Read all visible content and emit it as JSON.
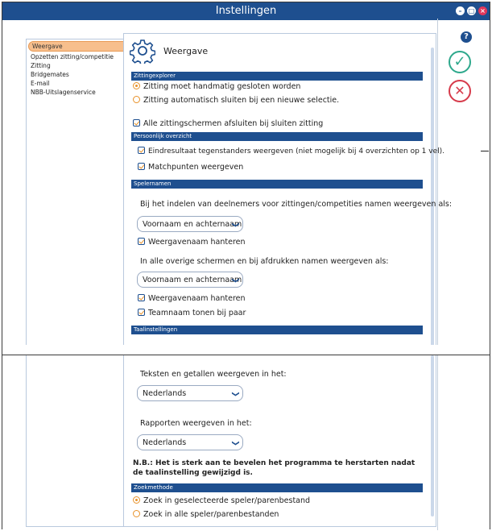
{
  "window": {
    "title": "Instellingen",
    "help_label": "?",
    "ok_label": "✓",
    "cancel_label": "✕"
  },
  "sidebar": {
    "items": [
      {
        "label": "Weergave",
        "active": true
      },
      {
        "label": "Opzetten zitting/competitie"
      },
      {
        "label": "Zitting"
      },
      {
        "label": "Bridgemates"
      },
      {
        "label": "E-mail"
      },
      {
        "label": "NBB-Uitslagenservice"
      }
    ]
  },
  "header": {
    "title": "Weergave",
    "icon": "gear-icon"
  },
  "sections": {
    "zittingexplorer": {
      "title": "Zittingexplorer",
      "opt_manual": "Zitting moet handmatig gesloten worden",
      "opt_auto": "Zitting automatisch sluiten bij een nieuwe selectie.",
      "close_all": "Alle zittingschermen afsluiten bij sluiten zitting"
    },
    "persoonlijk": {
      "title": "Persoonlijk overzicht",
      "eindresultaat": "Eindresultaat tegenstanders weergeven (niet mogelijk bij 4 overzichten op 1 vel).",
      "matchpunten": "Matchpunten weergeven"
    },
    "spelernamen": {
      "title": "Spelernamen",
      "intro1": "Bij het indelen van deelnemers voor zittingen/competities namen weergeven als:",
      "select1": "Voornaam en achternaam",
      "weergavenaam1": "Weergavenaam hanteren",
      "intro2": "In alle overige schermen en bij afdrukken namen weergeven als:",
      "select2": "Voornaam en achternaam",
      "weergavenaam2": "Weergavenaam hanteren",
      "teamnaam": "Teamnaam tonen bij paar"
    },
    "taal": {
      "title": "Taalinstellingen",
      "teksten_label": "Teksten en getallen weergeven in het:",
      "teksten_value": "Nederlands",
      "rapporten_label": "Rapporten weergeven in het:",
      "rapporten_value": "Nederlands",
      "note": "N.B.: Het is sterk aan te bevelen het programma te herstarten nadat de taalinstelling gewijzigd is."
    },
    "zoekmethode": {
      "title": "Zoekmethode",
      "opt_selected": "Zoek in geselecteerde speler/parenbestand",
      "opt_all": "Zoek in alle speler/parenbestanden"
    }
  },
  "colors": {
    "accent": "#1e4f8f",
    "orange": "#e8922a",
    "ok": "#2ea88c",
    "cancel": "#d63a4a"
  }
}
